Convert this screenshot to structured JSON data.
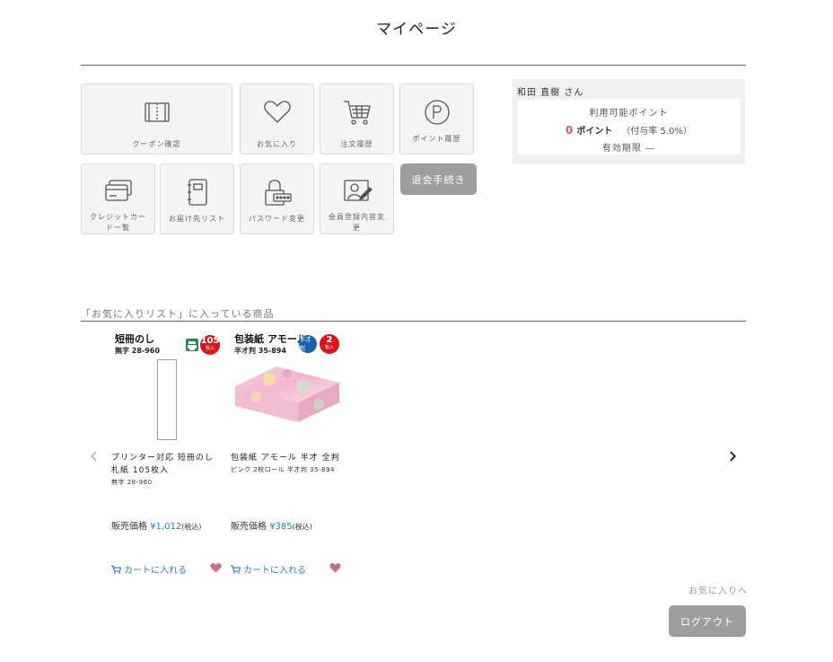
{
  "page": {
    "title": "マイページ"
  },
  "menu": {
    "coupon": "クーポン確認",
    "favorites": "お気に入り",
    "orders": "注文履歴",
    "points": "ポイント履歴",
    "credit": "クレジットカード一覧",
    "delivery": "お届け先リスト",
    "password": "パスワード変更",
    "profile": "会員登録内容変更",
    "withdraw": "退会手続き"
  },
  "member": {
    "name": "和田 直樹 さん",
    "points_label": "利用可能ポイント",
    "points_value": "0",
    "points_unit": "ポイント",
    "points_rate": "（付与率 5.0%）",
    "points_expiry": "有効期限 ―"
  },
  "favorites": {
    "heading": "「お気に入りリスト」に入っている商品",
    "view_all": "お気に入りへ",
    "items": [
      {
        "tag_title": "短冊のし",
        "tag_sub": "無字 28-960",
        "badge_qty": "105",
        "badge_unit": "枚入",
        "name": "プリンター対応 短冊のし 札紙 105枚入",
        "sub": "無字 28-960",
        "price_label": "販売価格",
        "price": "¥1,012",
        "tax": "(税込)",
        "cart": "カートに入れる"
      },
      {
        "tag_title": "包装紙 アモール",
        "tag_sub": "半才判 35-894",
        "badge_blue": "半才判",
        "badge_qty": "2",
        "badge_unit": "枚入",
        "name": "包装紙 アモール 半才 全判",
        "sub": "ピンク 2枚ロール 半才判 35-894",
        "price_label": "販売価格",
        "price": "¥385",
        "tax": "(税込)",
        "cart": "カートに入れる"
      }
    ]
  },
  "logout": "ログアウト",
  "colors": {
    "accent_blue": "#2a79bd",
    "points_pink": "#c0607a",
    "button_gray": "#9e9e9e",
    "heart": "#c8708a"
  }
}
